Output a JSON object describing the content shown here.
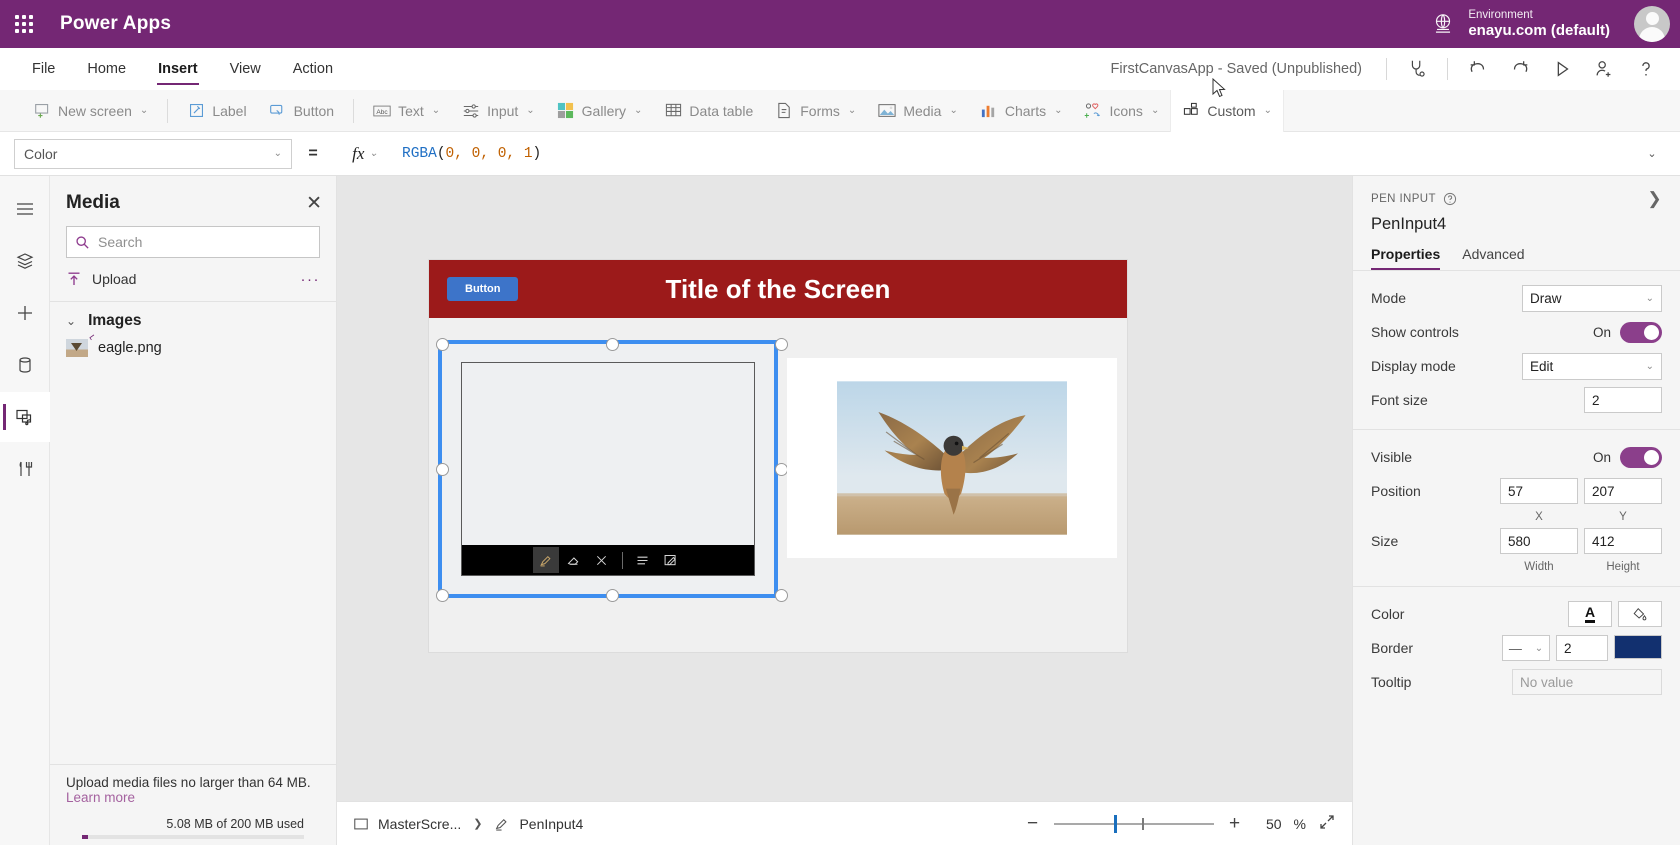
{
  "topbar": {
    "waffle_label": "app-launcher",
    "brand": "Power Apps",
    "env_label": "Environment",
    "env_value": "enayu.com (default)"
  },
  "menubar": {
    "items": [
      {
        "label": "File",
        "active": false
      },
      {
        "label": "Home",
        "active": false
      },
      {
        "label": "Insert",
        "active": true
      },
      {
        "label": "View",
        "active": false
      },
      {
        "label": "Action",
        "active": false
      }
    ],
    "save_state": "FirstCanvasApp - Saved (Unpublished)",
    "actions": [
      {
        "name": "app-checker-icon",
        "title": "App checker"
      },
      {
        "name": "undo-icon",
        "title": "Undo"
      },
      {
        "name": "redo-icon",
        "title": "Redo"
      },
      {
        "name": "preview-play-icon",
        "title": "Preview the app"
      },
      {
        "name": "share-user-icon",
        "title": "Share"
      },
      {
        "name": "help-icon",
        "title": "Help"
      }
    ]
  },
  "ribbon": {
    "items": [
      {
        "label": "New screen",
        "icon": "new-screen-icon",
        "caret": true
      },
      {
        "label": "Label",
        "icon": "label-icon",
        "caret": false
      },
      {
        "label": "Button",
        "icon": "button-icon",
        "caret": false
      },
      {
        "label": "Text",
        "icon": "text-icon",
        "caret": true
      },
      {
        "label": "Input",
        "icon": "input-icon",
        "caret": true
      },
      {
        "label": "Gallery",
        "icon": "gallery-icon",
        "caret": true
      },
      {
        "label": "Data table",
        "icon": "data-table-icon",
        "caret": false
      },
      {
        "label": "Forms",
        "icon": "forms-icon",
        "caret": true
      },
      {
        "label": "Media",
        "icon": "media-icon",
        "caret": true
      },
      {
        "label": "Charts",
        "icon": "charts-icon",
        "caret": true
      },
      {
        "label": "Icons",
        "icon": "icons-icon",
        "caret": true
      },
      {
        "label": "Custom",
        "icon": "custom-icon",
        "caret": true
      }
    ]
  },
  "formula_bar": {
    "property": "Color",
    "equals": "=",
    "fx": "fx",
    "formula_fn": "RGBA",
    "formula_open": "(",
    "formula_args": "0, 0, 0, 1",
    "formula_close": ")",
    "formula_full": "RGBA(0, 0, 0, 1)"
  },
  "rail": {
    "items": [
      {
        "name": "hamburger-menu-icon",
        "selected": false
      },
      {
        "name": "tree-view-layers-icon",
        "selected": false
      },
      {
        "name": "insert-plus-icon",
        "selected": false
      },
      {
        "name": "data-cylinder-icon",
        "selected": false
      },
      {
        "name": "media-panel-icon",
        "selected": true
      },
      {
        "name": "advanced-tools-icon",
        "selected": false
      }
    ]
  },
  "media_panel": {
    "title": "Media",
    "close_label": "✕",
    "search_placeholder": "Search",
    "search_value": "",
    "upload_label": "Upload",
    "more_label": "···",
    "group": {
      "label": "Images",
      "expanded": true
    },
    "files": [
      {
        "name": "eagle.png"
      }
    ],
    "footer_note": "Upload media files no larger than 64 MB.",
    "footer_link": "Learn more",
    "usage_text": "5.08 MB of 200 MB used"
  },
  "canvas": {
    "screen_button_label": "Button",
    "screen_title": "Title of the Screen",
    "pen_toolbar": [
      {
        "name": "pen-highlighter-icon",
        "active": true
      },
      {
        "name": "eraser-icon",
        "active": false
      },
      {
        "name": "clear-x-icon",
        "active": false
      },
      {
        "name": "divider",
        "active": false
      },
      {
        "name": "lines-list-icon",
        "active": false
      },
      {
        "name": "draw-edit-icon",
        "active": false
      }
    ],
    "image_alt": "eagle in flight"
  },
  "status_bar": {
    "screen_name": "MasterScre...",
    "control_name": "PenInput4",
    "zoom_minus": "−",
    "zoom_plus": "+",
    "zoom_value": "50",
    "zoom_unit": "%",
    "fit_label": "fit-to-screen-icon"
  },
  "properties": {
    "kicker": "PEN INPUT",
    "help_icon": "help-circle-icon",
    "expand_icon": "expand-chevron-icon",
    "control_name": "PenInput4",
    "tabs": [
      {
        "label": "Properties",
        "active": true
      },
      {
        "label": "Advanced",
        "active": false
      }
    ],
    "rows": {
      "mode": {
        "label": "Mode",
        "value": "Draw"
      },
      "show_controls": {
        "label": "Show controls",
        "state": "On"
      },
      "display_mode": {
        "label": "Display mode",
        "value": "Edit"
      },
      "font_size": {
        "label": "Font size",
        "value": "2"
      },
      "visible": {
        "label": "Visible",
        "state": "On"
      },
      "position": {
        "label": "Position",
        "x": "57",
        "y": "207",
        "x_caption": "X",
        "y_caption": "Y"
      },
      "size": {
        "label": "Size",
        "width": "580",
        "height": "412",
        "width_caption": "Width",
        "height_caption": "Height"
      },
      "color": {
        "label": "Color",
        "text_btn": "A",
        "fill_btn": "fill-bucket-icon"
      },
      "border": {
        "label": "Border",
        "style": "———",
        "thickness": "2",
        "swatch": "#12306f"
      },
      "tooltip": {
        "label": "Tooltip",
        "placeholder": "No value",
        "value": ""
      }
    }
  },
  "colors": {
    "brand_purple": "#742774",
    "accent_purple": "#8b3f8b",
    "screen_header_red": "#9c1a1a",
    "screen_button_blue": "#3d74c9",
    "selection_blue": "#3d8ef0",
    "border_swatch": "#12306f",
    "formula_fn_blue": "#1f6fc4",
    "formula_num_orange": "#c06000"
  }
}
